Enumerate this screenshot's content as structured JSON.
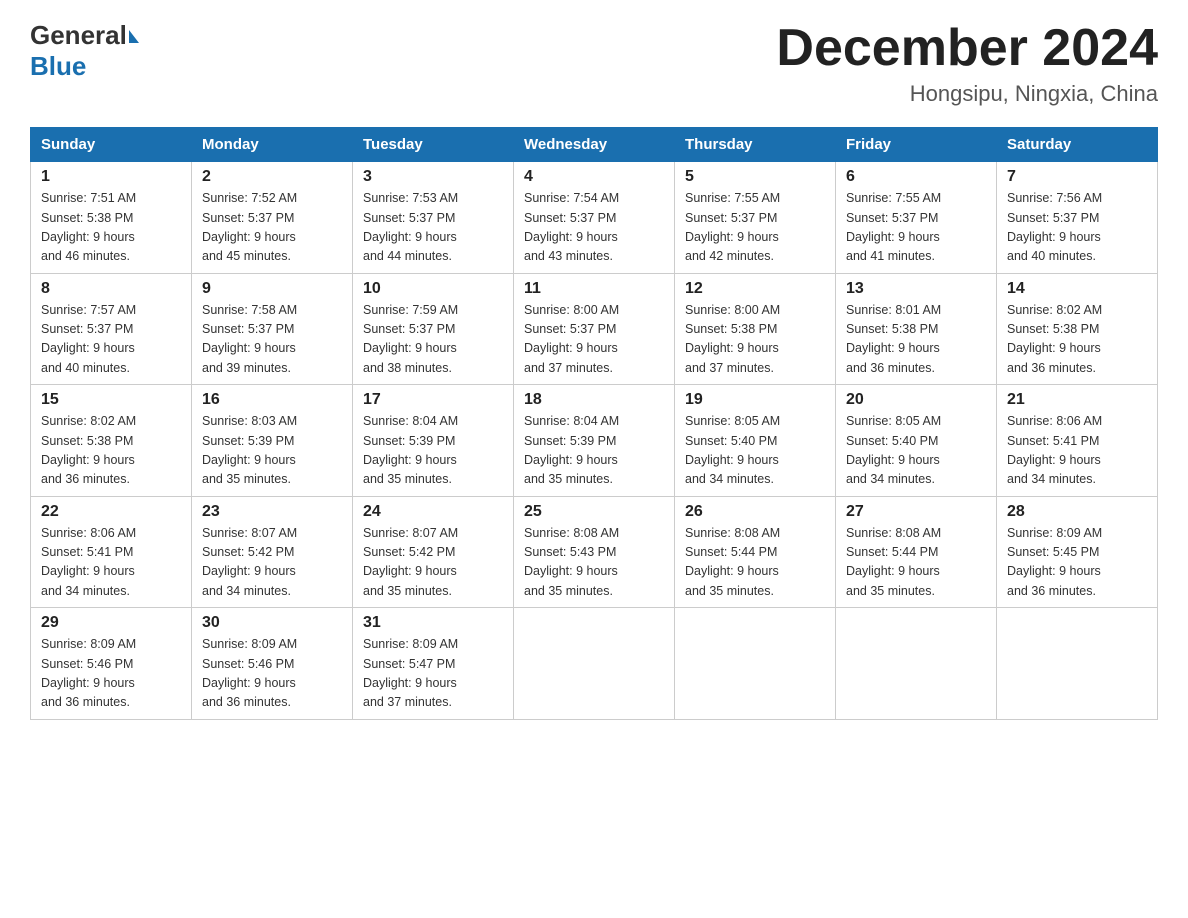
{
  "logo": {
    "general": "General",
    "blue": "Blue"
  },
  "title": {
    "month_year": "December 2024",
    "location": "Hongsipu, Ningxia, China"
  },
  "weekdays": [
    "Sunday",
    "Monday",
    "Tuesday",
    "Wednesday",
    "Thursday",
    "Friday",
    "Saturday"
  ],
  "weeks": [
    [
      {
        "day": "1",
        "sunrise": "7:51 AM",
        "sunset": "5:38 PM",
        "daylight": "9 hours and 46 minutes."
      },
      {
        "day": "2",
        "sunrise": "7:52 AM",
        "sunset": "5:37 PM",
        "daylight": "9 hours and 45 minutes."
      },
      {
        "day": "3",
        "sunrise": "7:53 AM",
        "sunset": "5:37 PM",
        "daylight": "9 hours and 44 minutes."
      },
      {
        "day": "4",
        "sunrise": "7:54 AM",
        "sunset": "5:37 PM",
        "daylight": "9 hours and 43 minutes."
      },
      {
        "day": "5",
        "sunrise": "7:55 AM",
        "sunset": "5:37 PM",
        "daylight": "9 hours and 42 minutes."
      },
      {
        "day": "6",
        "sunrise": "7:55 AM",
        "sunset": "5:37 PM",
        "daylight": "9 hours and 41 minutes."
      },
      {
        "day": "7",
        "sunrise": "7:56 AM",
        "sunset": "5:37 PM",
        "daylight": "9 hours and 40 minutes."
      }
    ],
    [
      {
        "day": "8",
        "sunrise": "7:57 AM",
        "sunset": "5:37 PM",
        "daylight": "9 hours and 40 minutes."
      },
      {
        "day": "9",
        "sunrise": "7:58 AM",
        "sunset": "5:37 PM",
        "daylight": "9 hours and 39 minutes."
      },
      {
        "day": "10",
        "sunrise": "7:59 AM",
        "sunset": "5:37 PM",
        "daylight": "9 hours and 38 minutes."
      },
      {
        "day": "11",
        "sunrise": "8:00 AM",
        "sunset": "5:37 PM",
        "daylight": "9 hours and 37 minutes."
      },
      {
        "day": "12",
        "sunrise": "8:00 AM",
        "sunset": "5:38 PM",
        "daylight": "9 hours and 37 minutes."
      },
      {
        "day": "13",
        "sunrise": "8:01 AM",
        "sunset": "5:38 PM",
        "daylight": "9 hours and 36 minutes."
      },
      {
        "day": "14",
        "sunrise": "8:02 AM",
        "sunset": "5:38 PM",
        "daylight": "9 hours and 36 minutes."
      }
    ],
    [
      {
        "day": "15",
        "sunrise": "8:02 AM",
        "sunset": "5:38 PM",
        "daylight": "9 hours and 36 minutes."
      },
      {
        "day": "16",
        "sunrise": "8:03 AM",
        "sunset": "5:39 PM",
        "daylight": "9 hours and 35 minutes."
      },
      {
        "day": "17",
        "sunrise": "8:04 AM",
        "sunset": "5:39 PM",
        "daylight": "9 hours and 35 minutes."
      },
      {
        "day": "18",
        "sunrise": "8:04 AM",
        "sunset": "5:39 PM",
        "daylight": "9 hours and 35 minutes."
      },
      {
        "day": "19",
        "sunrise": "8:05 AM",
        "sunset": "5:40 PM",
        "daylight": "9 hours and 34 minutes."
      },
      {
        "day": "20",
        "sunrise": "8:05 AM",
        "sunset": "5:40 PM",
        "daylight": "9 hours and 34 minutes."
      },
      {
        "day": "21",
        "sunrise": "8:06 AM",
        "sunset": "5:41 PM",
        "daylight": "9 hours and 34 minutes."
      }
    ],
    [
      {
        "day": "22",
        "sunrise": "8:06 AM",
        "sunset": "5:41 PM",
        "daylight": "9 hours and 34 minutes."
      },
      {
        "day": "23",
        "sunrise": "8:07 AM",
        "sunset": "5:42 PM",
        "daylight": "9 hours and 34 minutes."
      },
      {
        "day": "24",
        "sunrise": "8:07 AM",
        "sunset": "5:42 PM",
        "daylight": "9 hours and 35 minutes."
      },
      {
        "day": "25",
        "sunrise": "8:08 AM",
        "sunset": "5:43 PM",
        "daylight": "9 hours and 35 minutes."
      },
      {
        "day": "26",
        "sunrise": "8:08 AM",
        "sunset": "5:44 PM",
        "daylight": "9 hours and 35 minutes."
      },
      {
        "day": "27",
        "sunrise": "8:08 AM",
        "sunset": "5:44 PM",
        "daylight": "9 hours and 35 minutes."
      },
      {
        "day": "28",
        "sunrise": "8:09 AM",
        "sunset": "5:45 PM",
        "daylight": "9 hours and 36 minutes."
      }
    ],
    [
      {
        "day": "29",
        "sunrise": "8:09 AM",
        "sunset": "5:46 PM",
        "daylight": "9 hours and 36 minutes."
      },
      {
        "day": "30",
        "sunrise": "8:09 AM",
        "sunset": "5:46 PM",
        "daylight": "9 hours and 36 minutes."
      },
      {
        "day": "31",
        "sunrise": "8:09 AM",
        "sunset": "5:47 PM",
        "daylight": "9 hours and 37 minutes."
      },
      null,
      null,
      null,
      null
    ]
  ],
  "labels": {
    "sunrise_prefix": "Sunrise: ",
    "sunset_prefix": "Sunset: ",
    "daylight_prefix": "Daylight: "
  }
}
